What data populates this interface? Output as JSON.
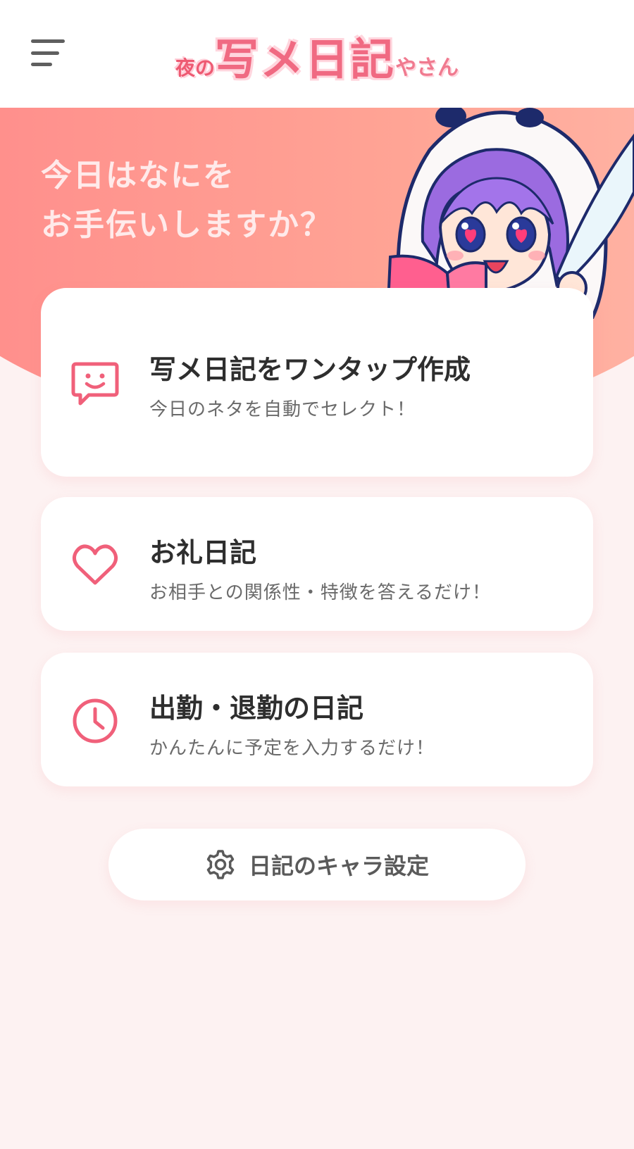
{
  "header": {
    "logo_prefix_1": "夜",
    "logo_prefix_2": "の",
    "logo_main": "写メ日記",
    "logo_suffix": "やさん"
  },
  "hero": {
    "greeting_line1": "今日はなにを",
    "greeting_line2": "お手伝いしますか？"
  },
  "menu_cards": [
    {
      "title": "写メ日記をワンタップ作成",
      "subtitle": "今日のネタを自動でセレクト！",
      "icon": "chat-smile-icon"
    },
    {
      "title": "お礼日記",
      "subtitle": "お相手との関係性・特徴を答えるだけ！",
      "icon": "heart-icon"
    },
    {
      "title": "出勤・退勤の日記",
      "subtitle": "かんたんに予定を入力するだけ！",
      "icon": "clock-icon"
    }
  ],
  "settings": {
    "label": "日記のキャラ設定",
    "icon": "gear-icon"
  },
  "colors": {
    "accent": "#f0607a",
    "hero_gradient_start": "#ff8a8a",
    "hero_gradient_end": "#ffb7a8",
    "background": "#fdf2f2"
  }
}
